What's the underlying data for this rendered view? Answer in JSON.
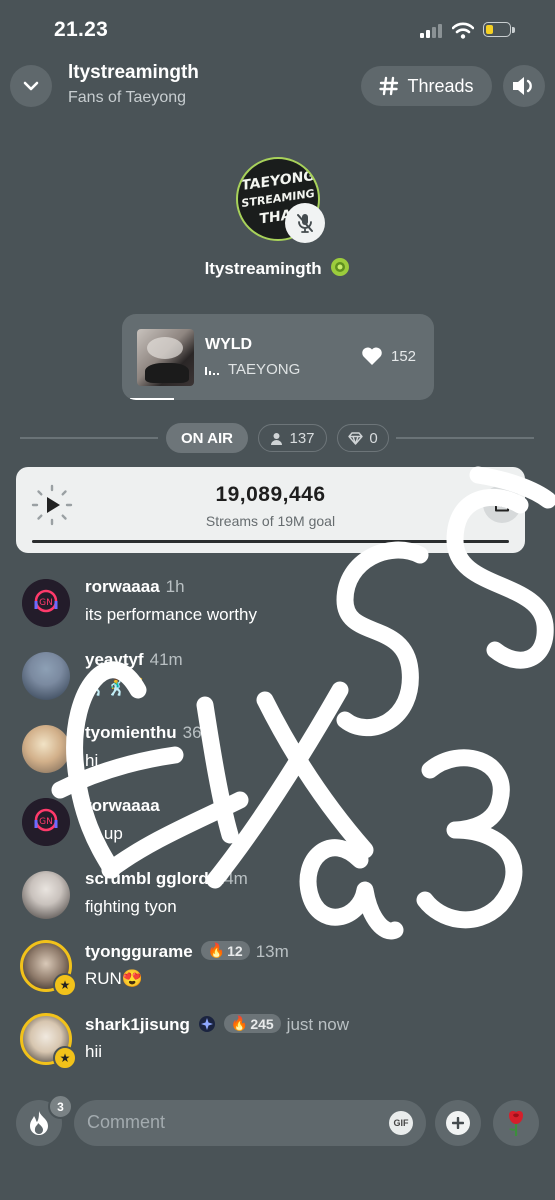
{
  "status_bar": {
    "time": "21.23"
  },
  "header": {
    "title": "ltystreamingth",
    "subtitle": "Fans of Taeyong",
    "threads_label": "Threads"
  },
  "host": {
    "name": "ltystreamingth",
    "avatar_text": [
      "TAEYONG",
      "STREAMING",
      "THAI"
    ]
  },
  "song": {
    "title": "WYLD",
    "artist": "TAEYONG",
    "likes": "152"
  },
  "room_stats": {
    "on_air": "ON AIR",
    "listeners": "137",
    "gems": "0"
  },
  "stream_goal": {
    "count": "19,089,446",
    "caption": "Streams of 19M goal",
    "progress": 1.0
  },
  "comments": [
    {
      "user": "rorwaaaa",
      "time": "1h",
      "text": "its performance worthy"
    },
    {
      "user": "yeaytyf",
      "time": "41m",
      "text": "🕺🕺🕺"
    },
    {
      "user": "tyomienthu",
      "time": "36m",
      "text": "hi"
    },
    {
      "user": "rorwaaaa",
      "time": "",
      "text": "th   up"
    },
    {
      "user": "scrumbl   gglord",
      "time": "24m",
      "text": "fighting tyon"
    },
    {
      "user": "tyonggurame",
      "streak": "12",
      "time": "13m",
      "text": "RUN😍"
    },
    {
      "user": "shark1jisung",
      "streak": "245",
      "time": "just now",
      "text": "hii"
    }
  ],
  "bottom_bar": {
    "fire_badge": "3",
    "comment_placeholder": "Comment",
    "gif_label": "GIF"
  },
  "overlay_scribble": "fix55 a 3"
}
